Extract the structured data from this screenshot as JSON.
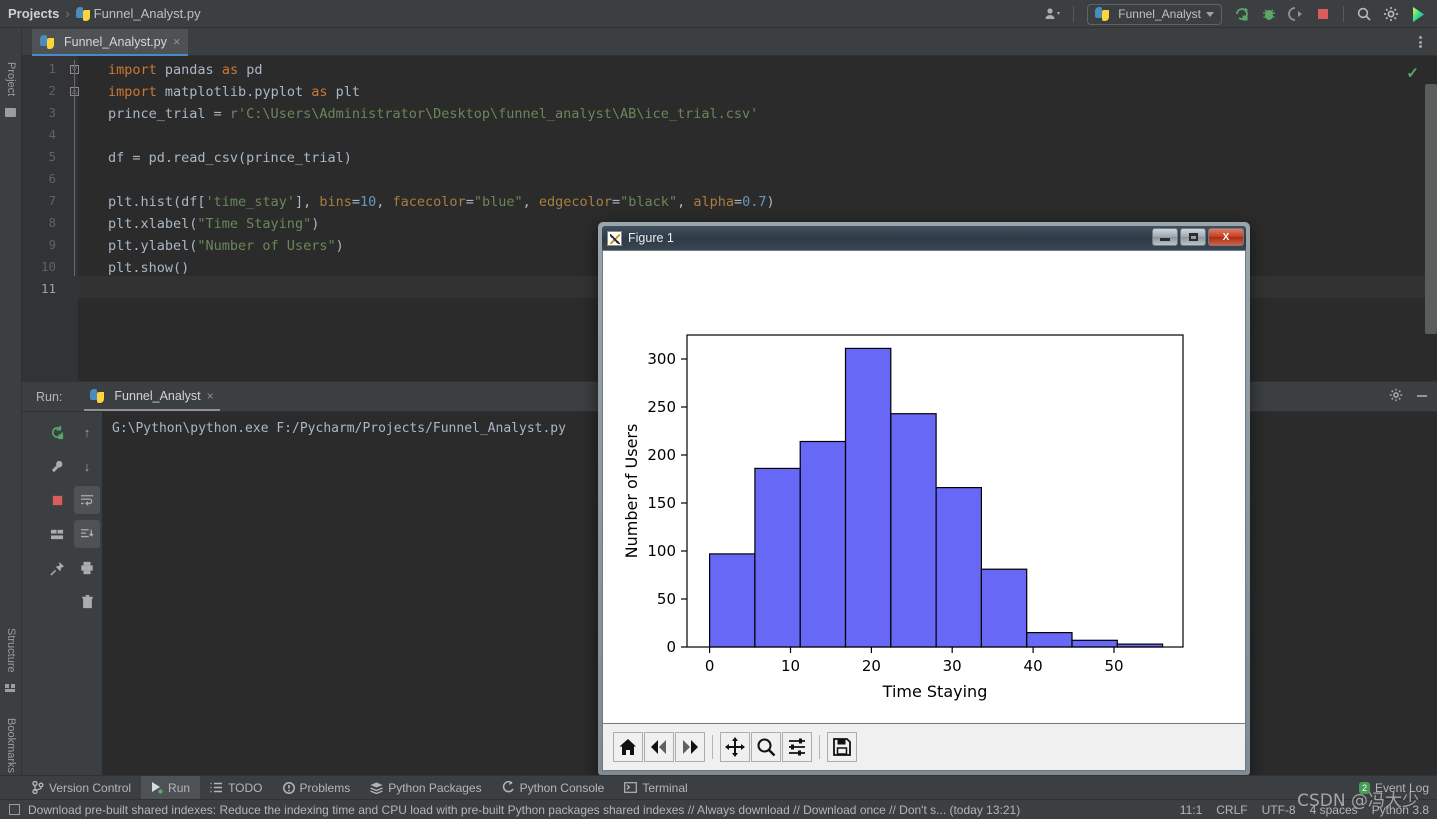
{
  "app": {
    "breadcrumb_root": "Projects",
    "breadcrumb_sep": "›",
    "breadcrumb_file": "Funnel_Analyst.py",
    "run_config_name": "Funnel_Analyst"
  },
  "left_strip": [
    {
      "label": "Project",
      "icon": "folder-icon"
    },
    {
      "label": "Structure",
      "icon": "structure-icon"
    },
    {
      "label": "Bookmarks",
      "icon": "bookmark-icon"
    }
  ],
  "editor": {
    "tab_label": "Funnel_Analyst.py",
    "tab_close": "×",
    "current_line": 11,
    "line_numbers": [
      "1",
      "2",
      "3",
      "4",
      "5",
      "6",
      "7",
      "8",
      "9",
      "10",
      "11"
    ],
    "lines": [
      {
        "n": 1,
        "tokens": [
          {
            "t": "kw",
            "v": "import"
          },
          {
            "t": "plain",
            "v": " pandas "
          },
          {
            "t": "kw",
            "v": "as"
          },
          {
            "t": "plain",
            "v": " pd"
          }
        ]
      },
      {
        "n": 2,
        "tokens": [
          {
            "t": "kw",
            "v": "import"
          },
          {
            "t": "plain",
            "v": " matplotlib.pyplot "
          },
          {
            "t": "kw",
            "v": "as"
          },
          {
            "t": "plain",
            "v": " plt"
          }
        ]
      },
      {
        "n": 3,
        "tokens": [
          {
            "t": "plain",
            "v": "prince_trial = "
          },
          {
            "t": "str",
            "v": "r'C:\\Users\\Administrator\\Desktop\\funnel_analyst\\AB\\ice_trial.csv'"
          }
        ]
      },
      {
        "n": 4,
        "tokens": []
      },
      {
        "n": 5,
        "tokens": [
          {
            "t": "plain",
            "v": "df = pd.read_csv(prince_trial)"
          }
        ]
      },
      {
        "n": 6,
        "tokens": []
      },
      {
        "n": 7,
        "tokens": [
          {
            "t": "plain",
            "v": "plt.hist(df["
          },
          {
            "t": "str",
            "v": "'time_stay'"
          },
          {
            "t": "plain",
            "v": "], "
          },
          {
            "t": "param",
            "v": "bins"
          },
          {
            "t": "plain",
            "v": "="
          },
          {
            "t": "num",
            "v": "10"
          },
          {
            "t": "plain",
            "v": ", "
          },
          {
            "t": "param",
            "v": "facecolor"
          },
          {
            "t": "plain",
            "v": "="
          },
          {
            "t": "str",
            "v": "\"blue\""
          },
          {
            "t": "plain",
            "v": ", "
          },
          {
            "t": "param",
            "v": "edgecolor"
          },
          {
            "t": "plain",
            "v": "="
          },
          {
            "t": "str",
            "v": "\"black\""
          },
          {
            "t": "plain",
            "v": ", "
          },
          {
            "t": "param",
            "v": "alpha"
          },
          {
            "t": "plain",
            "v": "="
          },
          {
            "t": "num",
            "v": "0.7"
          },
          {
            "t": "plain",
            "v": ")"
          }
        ]
      },
      {
        "n": 8,
        "tokens": [
          {
            "t": "plain",
            "v": "plt.xlabel("
          },
          {
            "t": "str",
            "v": "\"Time Staying\""
          },
          {
            "t": "plain",
            "v": ")"
          }
        ]
      },
      {
        "n": 9,
        "tokens": [
          {
            "t": "plain",
            "v": "plt.ylabel("
          },
          {
            "t": "str",
            "v": "\"Number of Users\""
          },
          {
            "t": "plain",
            "v": ")"
          }
        ]
      },
      {
        "n": 10,
        "tokens": [
          {
            "t": "plain",
            "v": "plt.show()"
          }
        ]
      },
      {
        "n": 11,
        "tokens": []
      }
    ]
  },
  "run_panel": {
    "label": "Run:",
    "tab_label": "Funnel_Analyst",
    "tab_close": "×",
    "console_text": "G:\\Python\\python.exe F:/Pycharm/Projects/Funnel_Analyst.py",
    "left_tools": [
      "rerun-icon",
      "wrench-icon",
      "stop-icon",
      "layout-icon",
      "pin-icon"
    ],
    "right_tools": [
      "up-arrow-icon",
      "down-arrow-icon",
      "soft-wrap-icon",
      "scroll-end-icon",
      "print-icon",
      "trash-icon"
    ],
    "header_tools": [
      "gear-icon",
      "minimize-icon"
    ]
  },
  "figure_window": {
    "title": "Figure 1",
    "minimize_label": "–",
    "maximize_label": "❐",
    "close_label": "X",
    "toolbar": [
      {
        "name": "home-icon",
        "tip": "Home"
      },
      {
        "name": "back-arrow-icon",
        "tip": "Back"
      },
      {
        "name": "forward-arrow-icon",
        "tip": "Forward"
      },
      {
        "name": "pan-move-icon",
        "tip": "Pan"
      },
      {
        "name": "zoom-magnifier-icon",
        "tip": "Zoom"
      },
      {
        "name": "configure-subplots-icon",
        "tip": "Subplots"
      },
      {
        "name": "save-floppy-icon",
        "tip": "Save"
      }
    ]
  },
  "chart_data": {
    "type": "bar",
    "title": "",
    "xlabel": "Time Staying",
    "ylabel": "Number of Users",
    "xlim": [
      -2.8,
      58.5
    ],
    "ylim": [
      0,
      325
    ],
    "xticks": [
      0,
      10,
      20,
      30,
      40,
      50
    ],
    "yticks": [
      0,
      50,
      100,
      150,
      200,
      250,
      300
    ],
    "grid": false,
    "legend": null,
    "bin_edges": [
      0.0,
      5.6,
      11.2,
      16.8,
      22.4,
      28.0,
      33.6,
      39.2,
      44.8,
      50.4,
      56.0
    ],
    "categories": [
      "0.0-5.6",
      "5.6-11.2",
      "11.2-16.8",
      "16.8-22.4",
      "22.4-28.0",
      "28.0-33.6",
      "33.6-39.2",
      "39.2-44.8",
      "44.8-50.4",
      "50.4-56.0"
    ],
    "values": [
      97,
      186,
      214,
      311,
      243,
      166,
      81,
      15,
      7,
      3
    ],
    "bar_facecolor": "#3d3df5",
    "bar_edgecolor": "#000000",
    "bar_alpha": 0.7,
    "bins": 10
  },
  "bottom_bar": {
    "items": [
      {
        "label": "Version Control",
        "icon": "branch-icon",
        "active": false
      },
      {
        "label": "Run",
        "icon": "run-play-icon",
        "active": true
      },
      {
        "label": "TODO",
        "icon": "todo-list-icon",
        "active": false
      },
      {
        "label": "Problems",
        "icon": "problems-icon",
        "active": false
      },
      {
        "label": "Python Packages",
        "icon": "packages-icon",
        "active": false
      },
      {
        "label": "Python Console",
        "icon": "python-console-icon",
        "active": false
      },
      {
        "label": "Terminal",
        "icon": "terminal-icon",
        "active": false
      }
    ],
    "event_log_label": "Event Log",
    "event_log_count": "2"
  },
  "status_bar": {
    "message": "Download pre-built shared indexes: Reduce the indexing time and CPU load with pre-built Python packages shared indexes // Always download // Download once // Don't s... (today 13:21)",
    "caret": "11:1",
    "line_sep": "CRLF",
    "encoding": "UTF-8",
    "indent": "4 spaces",
    "interpreter": "Python 3.8"
  },
  "watermark": "CSDN @冯大少"
}
